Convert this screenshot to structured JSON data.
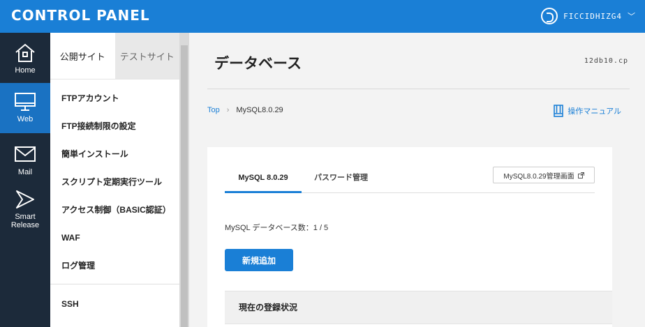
{
  "header": {
    "app_title": "CONTROL PANEL",
    "account_name": "FICCIDHIZG4",
    "caret": "﹀"
  },
  "leftnav": {
    "items": [
      {
        "label": "Home",
        "icon": "home-icon"
      },
      {
        "label": "Web",
        "icon": "monitor-icon"
      },
      {
        "label": "Mail",
        "icon": "mail-icon"
      },
      {
        "label": "Smart",
        "label2": "Release",
        "icon": "smart-release-icon"
      }
    ]
  },
  "submenu": {
    "tabs": [
      "公開サイト",
      "テストサイト"
    ],
    "items": [
      "FTPアカウント",
      "FTP接続制限の設定",
      "簡単インストール",
      "スクリプト定期実行ツール",
      "アクセス制御（BASIC認証）",
      "WAF",
      "ログ管理"
    ],
    "items2": [
      "SSH"
    ]
  },
  "main": {
    "title": "データベース",
    "server_id": "12db10.cp",
    "breadcrumb": {
      "top": "Top",
      "sep": "›",
      "current": "MySQL8.0.29"
    },
    "manual_label": "操作マニュアル",
    "tabs": [
      "MySQL 8.0.29",
      "パスワード管理"
    ],
    "ext_button": "MySQL8.0.29管理画面",
    "db_count": "MySQL データベース数：1 / 5",
    "add_button": "新規追加",
    "status_heading": "現在の登録状況"
  },
  "colors": {
    "brand": "#1a7fd6",
    "nav_bg": "#1c2a3a",
    "nav_active": "#1a72c2"
  }
}
